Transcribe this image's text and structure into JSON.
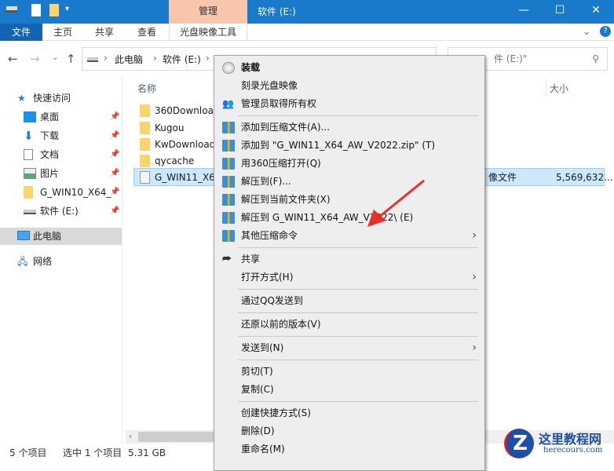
{
  "window": {
    "title": "软件 (E:)",
    "context_tab": "管理",
    "controls": [
      "—",
      "☐",
      "✕"
    ]
  },
  "ribbon": {
    "tabs": [
      "文件",
      "主页",
      "共享",
      "查看",
      "光盘映像工具"
    ]
  },
  "address": {
    "path": [
      "此电脑",
      "软件 (E:)"
    ],
    "search_placeholder": "件 (E:)\""
  },
  "sidebar": {
    "quick_access": "快速访问",
    "items": [
      "桌面",
      "下载",
      "文档",
      "图片",
      "G_WIN10_X64_",
      "软件 (E:)"
    ],
    "this_pc": "此电脑",
    "network": "网络"
  },
  "content": {
    "col_name": "名称",
    "col_size": "大小",
    "files": [
      "360Downloa",
      "Kugou",
      "KwDownload",
      "qycache",
      "G_WIN11_X6"
    ],
    "selected_type": "像文件",
    "selected_size": "5,569,632..."
  },
  "status": {
    "count": "5 个项目",
    "selected": "选中 1 个项目",
    "size": "5.31 GB"
  },
  "menu": {
    "items": [
      "装载",
      "刻录光盘映像",
      "管理员取得所有权",
      "添加到压缩文件(A)...",
      "添加到 \"G_WIN11_X64_AW_V2022.zip\" (T)",
      "用360压缩打开(Q)",
      "解压到(F)...",
      "解压到当前文件夹(X)",
      "解压到 G_WIN11_X64_AW_V2022\\ (E)",
      "其他压缩命令",
      "共享",
      "打开方式(H)",
      "通过QQ发送到",
      "还原以前的版本(V)",
      "发送到(N)",
      "剪切(T)",
      "复制(C)",
      "创建快捷方式(S)",
      "删除(D)",
      "重命名(M)"
    ]
  },
  "watermark": {
    "name": "这里教程网",
    "url": "herecours.com"
  },
  "colors": {
    "title_blue": "#1979ca",
    "manage_tab": "#f7c6ab",
    "selection": "#cce8ff",
    "arrow": "#e8302a"
  }
}
